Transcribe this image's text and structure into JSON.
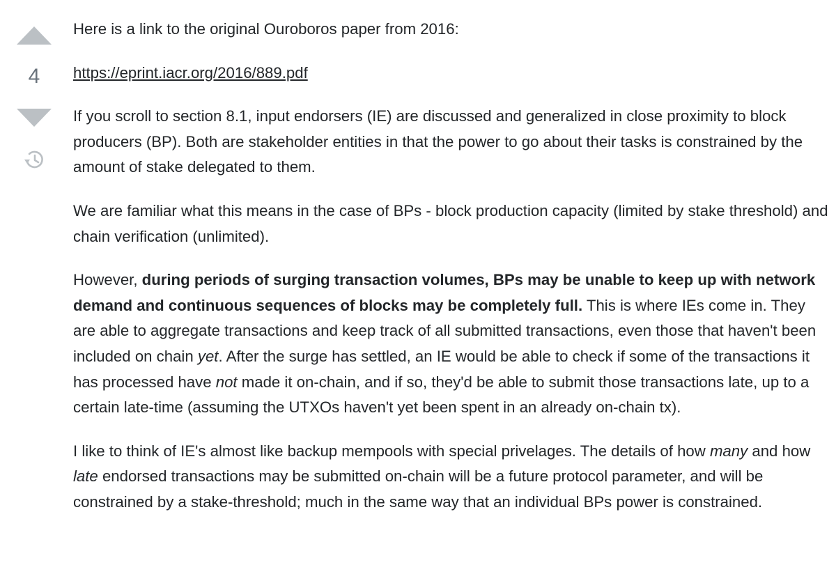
{
  "vote": {
    "score": "4",
    "up_icon": "triangle-up-icon",
    "down_icon": "triangle-down-icon",
    "history_icon": "history-icon",
    "colors": {
      "arrow": "#bbc0c4",
      "score": "#6a737c"
    }
  },
  "post": {
    "p1": "Here is a link to the original Ouroboros paper from 2016:",
    "link": "https://eprint.iacr.org/2016/889.pdf",
    "p3": "If you scroll to section 8.1, input endorsers (IE) are discussed and generalized in close proximity to block producers (BP). Both are stakeholder entities in that the power to go about their tasks is constrained by the amount of stake delegated to them.",
    "p4": "We are familiar what this means in the case of BPs - block production capacity (limited by stake threshold) and chain verification (unlimited).",
    "p5": {
      "a": "However, ",
      "bold": "during periods of surging transaction volumes, BPs may be unable to keep up with network demand and continuous sequences of blocks may be completely full.",
      "b": " This is where IEs come in. They are able to aggregate transactions and keep track of all submitted transactions, even those that haven't been included on chain ",
      "em1": "yet",
      "c": ". After the surge has settled, an IE would be able to check if some of the transactions it has processed have ",
      "em2": "not",
      "d": " made it on-chain, and if so, they'd be able to submit those transactions late, up to a certain late-time (assuming the UTXOs haven't yet been spent in an already on-chain tx)."
    },
    "p6": {
      "a": "I like to think of IE's almost like backup mempools with special privelages. The details of how ",
      "em1": "many",
      "b": " and how ",
      "em2": "late",
      "c": " endorsed transactions may be submitted on-chain will be a future protocol parameter, and will be constrained by a stake-threshold; much in the same way that an individual BPs power is constrained."
    }
  }
}
